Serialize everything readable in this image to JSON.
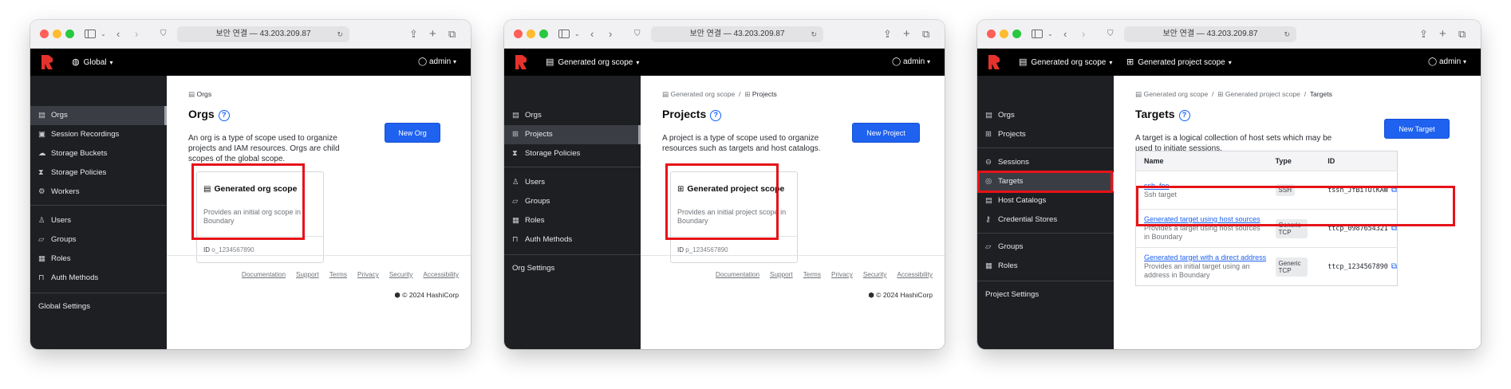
{
  "browser": {
    "address": "보안 연결 — 43.203.209.87"
  },
  "copyright": "© 2024 HashiCorp",
  "footer_links": [
    "Documentation",
    "Support",
    "Terms",
    "Privacy",
    "Security",
    "Accessibility"
  ],
  "user": "admin",
  "colors": {
    "highlight": "#e51318",
    "primary_button": "#1f62f0",
    "sidebar": "#1e1f22",
    "appbar": "#000000"
  },
  "win1": {
    "scope": "Global",
    "nav": [
      "Orgs",
      "Session Recordings",
      "Storage Buckets",
      "Storage Policies",
      "Workers",
      "Users",
      "Groups",
      "Roles",
      "Auth Methods"
    ],
    "nav_icons": [
      "org-icon",
      "recording-icon",
      "bucket-icon",
      "hourglass-icon",
      "gear-icon",
      "user-icon",
      "users-icon",
      "roles-icon",
      "lock-icon"
    ],
    "settings": "Global Settings",
    "breadcrumb": "Orgs",
    "title": "Orgs",
    "description": "An org is a type of scope used to organize projects and IAM resources. Orgs are child scopes of the global scope.",
    "button": "New Org",
    "card": {
      "title": "Generated org scope",
      "description": "Provides an initial org scope in Boundary",
      "id_label": "ID",
      "id": "o_1234567890"
    }
  },
  "win2": {
    "scope": "Generated org scope",
    "nav": [
      "Orgs",
      "Projects",
      "Storage Policies",
      "Users",
      "Groups",
      "Roles",
      "Auth Methods"
    ],
    "settings": "Org Settings",
    "breadcrumb": [
      "Generated org scope",
      "Projects"
    ],
    "title": "Projects",
    "description": "A project is a type of scope used to organize resources such as targets and host catalogs.",
    "button": "New Project",
    "card": {
      "title": "Generated project scope",
      "description": "Provides an initial project scope in Boundary",
      "id_label": "ID",
      "id": "p_1234567890"
    }
  },
  "win3": {
    "scope_org": "Generated org scope",
    "scope_project": "Generated project scope",
    "nav": [
      "Orgs",
      "Projects",
      "Sessions",
      "Targets",
      "Host Catalogs",
      "Credential Stores",
      "Groups",
      "Roles"
    ],
    "settings": "Project Settings",
    "breadcrumb": [
      "Generated org scope",
      "Generated project scope",
      "Targets"
    ],
    "title": "Targets",
    "description": "A target is a logical collection of host sets which may be used to initiate sessions.",
    "button": "New Target",
    "table": {
      "headers": [
        "Name",
        "Type",
        "ID"
      ],
      "rows": [
        {
          "name": "ssh_foo",
          "description": "Ssh target",
          "type": "SSH",
          "id": "tssh_JfBiTUlKAW"
        },
        {
          "name": "Generated target using host sources",
          "description": "Provides a target using host sources in Boundary",
          "type": "Generic TCP",
          "id": "ttcp_0987654321"
        },
        {
          "name": "Generated target with a direct address",
          "description": "Provides an initial target using an address in Boundary",
          "type": "Generic TCP",
          "id": "ttcp_1234567890"
        }
      ]
    }
  }
}
